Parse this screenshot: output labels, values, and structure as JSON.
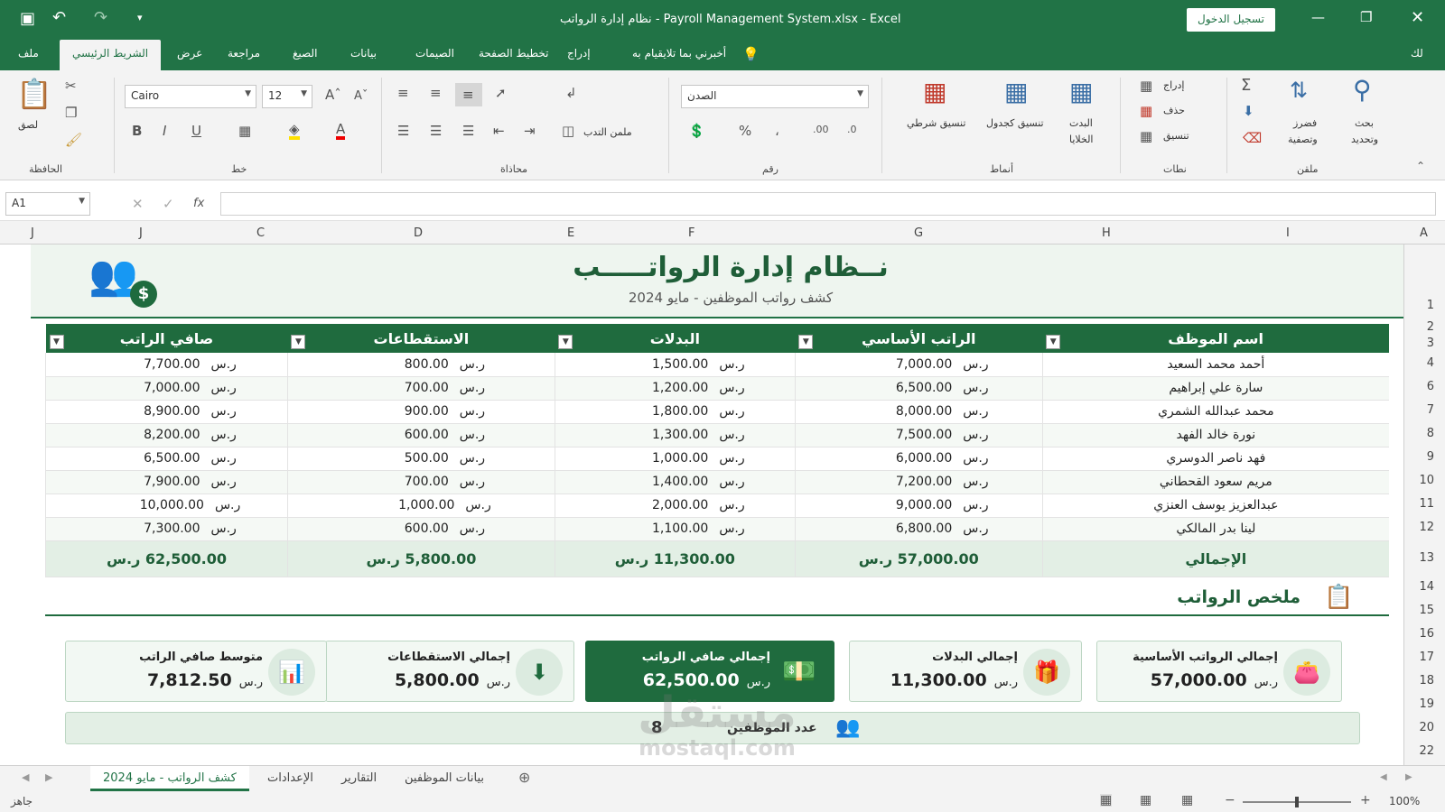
{
  "app": {
    "title": "نظام إدارة الرواتب - Payroll Management System.xlsx - Excel",
    "signin": "تسجيل الدخول"
  },
  "tabs": {
    "file": "ملف",
    "home": "الشريط الرئيسي",
    "view": "عرض",
    "review": "مراجعة",
    "formulas": "الصيغ",
    "data": "بيانات",
    "design": "الصيمات",
    "layout": "تخطيط الصفحة",
    "insert": "إدراج",
    "tellme": "أخبرني بما تلايقيام به",
    "share": "لك"
  },
  "ribbon": {
    "clipboard": {
      "group": "الحافظة",
      "paste": "لصق"
    },
    "font": {
      "group": "خط",
      "name": "Cairo",
      "size": "12"
    },
    "alignment": {
      "group": "محاذاة",
      "merge": "ملمن التدب"
    },
    "number": {
      "group": "رقم",
      "format": "الصدن"
    },
    "styles": {
      "group": "أنماط",
      "conditional": "تنسيق شرطي",
      "table": "تنسيق كجدول",
      "cell": "البدت",
      "cell2": "الخلايا"
    },
    "cells": {
      "group": "نطات",
      "insert": "إدراج",
      "delete": "حذف",
      "format": "تنسيق"
    },
    "editing": {
      "group": "ملقن",
      "sort": "فضرز",
      "sort2": "وتصفية",
      "find": "بحث",
      "find2": "وتحديد"
    }
  },
  "formula_bar": {
    "name_box": "A1",
    "fx": "fx"
  },
  "columns": [
    "A",
    "I",
    "H",
    "G",
    "F",
    "E",
    "D",
    "C",
    "J",
    "J"
  ],
  "rows": [
    "1",
    "2",
    "3",
    "4",
    "6",
    "7",
    "8",
    "9",
    "10",
    "11",
    "12",
    "13",
    "14",
    "15",
    "16",
    "17",
    "18",
    "19",
    "20",
    "22"
  ],
  "banner": {
    "title": "نــظام إدارة الرواتـــــب",
    "subtitle": "كشف رواتب الموظفين - مايو 2024"
  },
  "table": {
    "headers": [
      "اسم الموظف",
      "الراتب الأساسي",
      "البدلات",
      "الاستقطاعات",
      "صافي الراتب"
    ],
    "currency": "ر.س",
    "rows": [
      [
        "أحمد محمد السعيد",
        "7,000.00",
        "1,500.00",
        "800.00",
        "7,700.00"
      ],
      [
        "سارة علي إبراهيم",
        "6,500.00",
        "1,200.00",
        "700.00",
        "7,000.00"
      ],
      [
        "محمد عبدالله الشمري",
        "8,000.00",
        "1,800.00",
        "900.00",
        "8,900.00"
      ],
      [
        "نورة خالد الفهد",
        "7,500.00",
        "1,300.00",
        "600.00",
        "8,200.00"
      ],
      [
        "فهد ناصر الدوسري",
        "6,000.00",
        "1,000.00",
        "500.00",
        "6,500.00"
      ],
      [
        "مريم سعود القحطاني",
        "7,200.00",
        "1,400.00",
        "700.00",
        "7,900.00"
      ],
      [
        "عبدالعزيز يوسف العنزي",
        "9,000.00",
        "2,000.00",
        "1,000.00",
        "10,000.00"
      ],
      [
        "لينا بدر المالكي",
        "6,800.00",
        "1,100.00",
        "600.00",
        "7,300.00"
      ]
    ],
    "total_label": "الإجمالي",
    "totals": [
      "57,000.00",
      "11,300.00",
      "5,800.00",
      "62,500.00"
    ]
  },
  "summary": {
    "title": "ملخص الرواتب",
    "cards": [
      {
        "label": "إجمالي الرواتب الأساسية",
        "value": "57,000.00",
        "icon": "wallet-icon"
      },
      {
        "label": "إجمالي البدلات",
        "value": "11,300.00",
        "icon": "gift-icon"
      },
      {
        "label": "إجمالي صافي الرواتب",
        "value": "62,500.00",
        "icon": "cash-icon"
      },
      {
        "label": "إجمالي الاستقطاعات",
        "value": "5,800.00",
        "icon": "download-icon"
      },
      {
        "label": "متوسط صافي الراتب",
        "value": "7,812.50",
        "icon": "bar-chart-icon"
      }
    ],
    "count_label": "عدد الموظفين",
    "count_value": "8"
  },
  "sheet_tabs": [
    "كشف الرواتب - مايو 2024",
    "الإعدادات",
    "التقارير",
    "بيانات الموظفين"
  ],
  "status": {
    "ready": "جاهز",
    "zoom": "100%"
  },
  "watermark": {
    "text1": "مستقل",
    "text2": "mostaql.com"
  },
  "colors": {
    "brand": "#217346",
    "header": "#1f6b3e"
  }
}
